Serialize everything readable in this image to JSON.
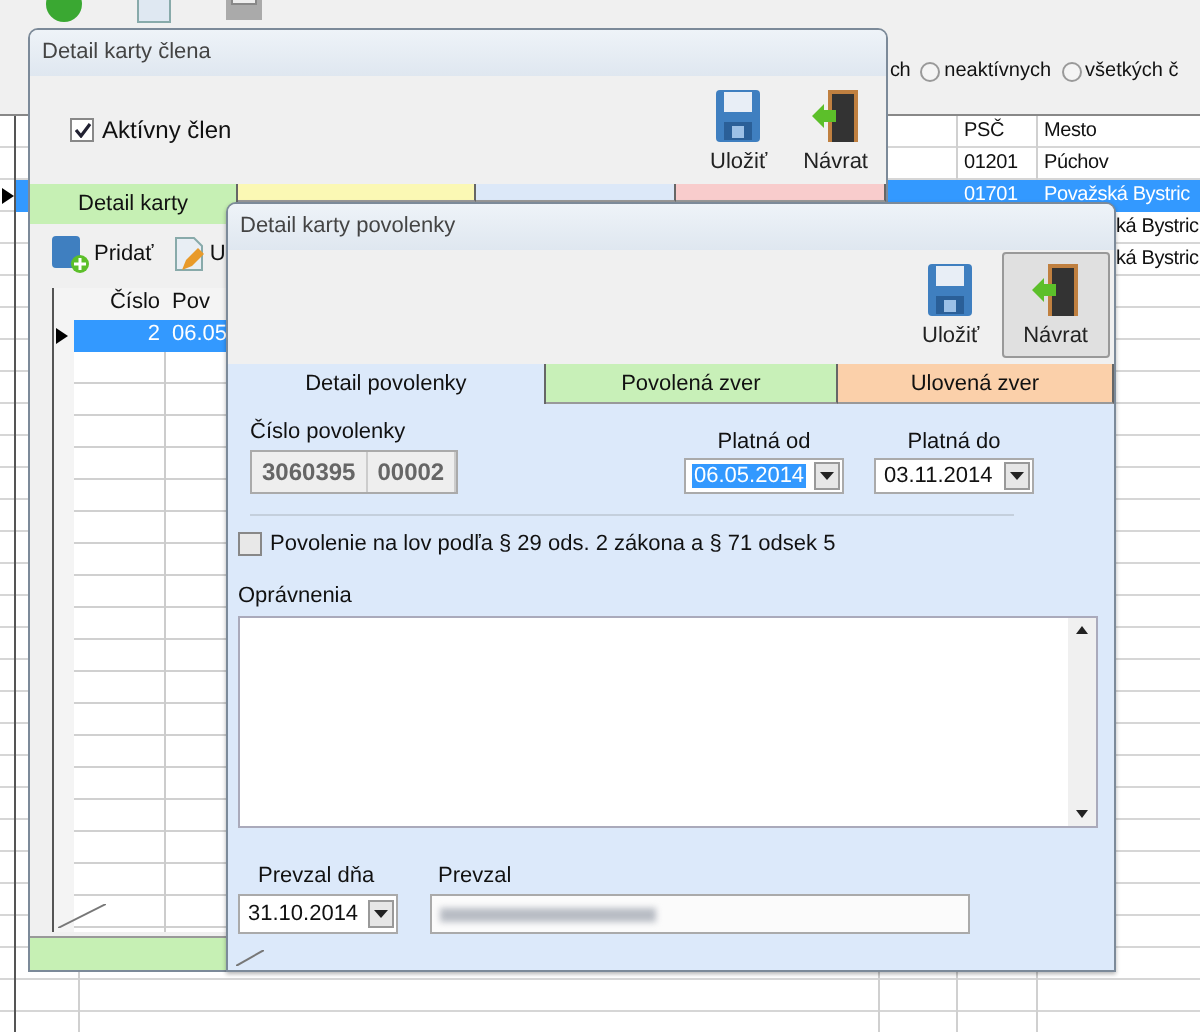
{
  "background_app": {
    "toolbar": [
      {
        "kind": "add"
      },
      {
        "kind": "document"
      },
      {
        "kind": "printer"
      }
    ],
    "filter": {
      "partial_label": "ch",
      "radios": [
        {
          "label": "neaktívnych",
          "selected": false
        },
        {
          "label": "všetkých č",
          "selected": false
        }
      ]
    },
    "table": {
      "columns": [
        "PSČ",
        "Mesto"
      ],
      "rows": [
        {
          "psc": "01201",
          "mesto": "Púchov",
          "selected": false
        },
        {
          "psc": "01701",
          "mesto": "Považská Bystric",
          "selected": true
        },
        {
          "mesto": "ká Bystric",
          "selected": false
        },
        {
          "mesto": "ká Bystric",
          "selected": false
        }
      ]
    }
  },
  "member_window": {
    "title": "Detail karty člena",
    "active_member": {
      "label": "Aktívny člen",
      "checked": true
    },
    "buttons": [
      {
        "label": "Uložiť",
        "kind": "save"
      },
      {
        "label": "Návrat",
        "kind": "back"
      }
    ],
    "tabs": [
      {
        "label": "Detail karty",
        "selected": true,
        "color": "#c6f0b4"
      },
      {
        "selected": false,
        "color": "#fbf8b4"
      },
      {
        "selected": false,
        "color": "#dce8f8"
      },
      {
        "selected": false,
        "color": "#f8cccc"
      }
    ],
    "toolbar": [
      {
        "label": "Pridať",
        "kind": "add"
      },
      {
        "label": "U",
        "kind": "edit"
      }
    ],
    "grid": {
      "columns": [
        "Číslo",
        "Pov"
      ],
      "rows": [
        {
          "cells": [
            "2",
            "06.05"
          ],
          "selected": true
        }
      ]
    }
  },
  "permit_window": {
    "title": "Detail karty povolenky",
    "buttons": [
      {
        "label": "Uložiť",
        "kind": "save",
        "pressed": false
      },
      {
        "label": "Návrat",
        "kind": "back",
        "pressed": true
      }
    ],
    "tabs": [
      {
        "label": "Detail povolenky",
        "selected": true,
        "color": "#dce9fa"
      },
      {
        "label": "Povolená zver",
        "selected": false,
        "color": "#c8f0b8"
      },
      {
        "label": "Ulovená zver",
        "selected": false,
        "color": "#fbd0aa"
      }
    ],
    "permit_number": {
      "label": "Číslo povolenky",
      "values": [
        "3060395",
        "00002"
      ]
    },
    "valid_from": {
      "label": "Platná od",
      "value": "06.05.2014",
      "text_selected": true
    },
    "valid_to": {
      "label": "Platná do",
      "value": "03.11.2014",
      "text_selected": false
    },
    "hunting_permit": {
      "label": "Povolenie na lov podľa § 29 ods. 2 zákona a § 71 odsek 5",
      "checked": false
    },
    "permissions": {
      "label": "Oprávnenia"
    },
    "received_on": {
      "label": "Prevzal dňa",
      "value": "31.10.2014"
    },
    "received_by": {
      "label": "Prevzal"
    }
  }
}
